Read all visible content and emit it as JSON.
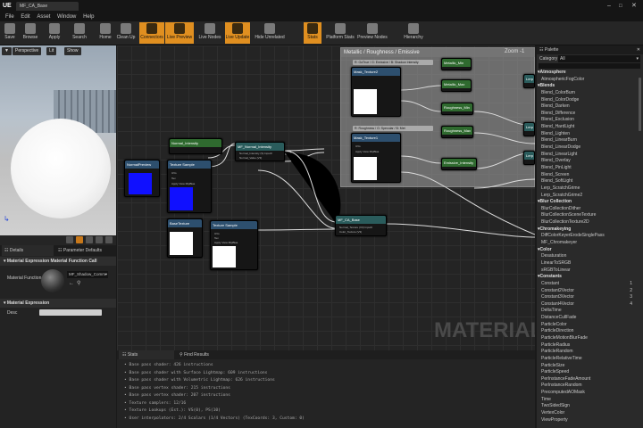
{
  "window": {
    "title": "MF_CA_Base",
    "logo": "UE"
  },
  "menu": [
    "File",
    "Edit",
    "Asset",
    "Window",
    "Help"
  ],
  "toolbar": [
    {
      "label": "Save",
      "icon": "save-icon"
    },
    {
      "label": "Browse",
      "icon": "browse-icon"
    },
    {
      "label": "Apply",
      "icon": "apply-icon"
    },
    {
      "label": "Search",
      "icon": "search-icon"
    },
    {
      "label": "Home",
      "icon": "home-icon"
    },
    {
      "label": "Clean Up",
      "icon": "clean-up-icon"
    },
    {
      "label": "Connectors",
      "icon": "connectors-icon",
      "active": true
    },
    {
      "label": "Live Preview",
      "icon": "live-preview-icon",
      "active": true
    },
    {
      "label": "Live Nodes",
      "icon": "live-nodes-icon"
    },
    {
      "label": "Live Update",
      "icon": "live-update-icon",
      "active": true
    },
    {
      "label": "Hide Unrelated",
      "icon": "hide-unrelated-icon"
    },
    {
      "label": "Stats",
      "icon": "stats-icon",
      "active": true
    },
    {
      "label": "Platform Stats",
      "icon": "platform-stats-icon"
    },
    {
      "label": "Preview Nodes",
      "icon": "preview-nodes-icon"
    },
    {
      "label": "Hierarchy",
      "icon": "hierarchy-icon"
    }
  ],
  "viewport": {
    "perspective": "Perspective",
    "lit": "Lit",
    "show": "Show"
  },
  "details": {
    "tab1": "Details",
    "tab2": "Parameter Defaults",
    "section1": "Material Expression Material Function Call",
    "function_label": "Material Function",
    "function_value": "MF_Shadow_Comm",
    "section2": "Material Expression",
    "desc_label": "Desc"
  },
  "graph": {
    "comment_title": "Metallic / Roughness / Emissive",
    "zoom": "Zoom -1",
    "watermark": "MATERIAL"
  },
  "nodes": {
    "normal_preview": {
      "title": "NormalPreview",
      "sub": "Texture Sample"
    },
    "texture_sample_1": {
      "title": "Texture Sample",
      "pins": [
        "UVs",
        "Tex",
        "Apply View MipBias"
      ],
      "out": [
        "RGB",
        "R",
        "G",
        "B",
        "A",
        "RGBA"
      ]
    },
    "normal_intensity": {
      "title": "Normal_Intensity",
      "sub": "Param (1)"
    },
    "mf_normal_intensity": {
      "title": "MF_Normal_Intensity",
      "pins": [
        "Normal_Intensity (S) Input0",
        "Normal_Value (V3)"
      ]
    },
    "mf_ca_base": {
      "title": "MF_CA_Base",
      "pins": [
        "Normal_Texture (V3) Input0",
        "Color_Texture (V3)"
      ]
    },
    "base_texture": {
      "title": "BaseTexture",
      "sub": "Texture Sample"
    },
    "texture_sample_2": {
      "title": "Texture Sample",
      "pins": [
        "UVs",
        "Tex",
        "Apply View MipBias"
      ],
      "out": [
        "RGB",
        "R",
        "G",
        "B",
        "A",
        "RGBA"
      ]
    },
    "mask_texture": {
      "title": "Mask_Texture2",
      "sub": "Texture Sample",
      "pins": [
        "UVs",
        "Tex",
        "Apply View MipBias"
      ]
    },
    "mask_texture2": {
      "title": "Mask_Texture1",
      "sub": "Texture Sample",
      "pins": [
        "UVs",
        "Tex",
        "Apply View MipBias"
      ]
    },
    "reroute_labels": [
      "R: GaTrue / G: Emissive / B: Shadow Intensity",
      "R: Roughness / G: Specular / B: Met"
    ],
    "metallic_min": "Metallic_Min",
    "metallic_max": "Metallic_Max",
    "roughness_min": "Roughness_Min",
    "roughness_max": "Roughness_Max",
    "emissive_intensity": "Emissive_Intensity",
    "lerp": "Lerp"
  },
  "stats": {
    "tab1": "Stats",
    "tab2": "Find Results",
    "lines": [
      "Base pass shader: 426 instructions",
      "Base pass shader with Surface Lightmap: 609 instructions",
      "Base pass shader with Volumetric Lightmap: 626 instructions",
      "Base pass vertex shader: 215 instructions",
      "Base pass vertex shader: 207 instructions",
      "Texture samplers: 12/16",
      "Texture Lookups (Est.): VS(0), PS(10)",
      "User interpolators: 2/4 Scalars (1/4 Vectors) (TexCoords: 3, Custom: 0)"
    ]
  },
  "palette": {
    "title": "Palette",
    "category_label": "Category",
    "category_value": "All",
    "items": [
      {
        "label": "Atmosphere",
        "cat": true
      },
      {
        "label": "AtmosphericFogColor"
      },
      {
        "label": "Blends",
        "cat": true
      },
      {
        "label": "Blend_ColorBurn"
      },
      {
        "label": "Blend_ColorDodge"
      },
      {
        "label": "Blend_Darken"
      },
      {
        "label": "Blend_Difference"
      },
      {
        "label": "Blend_Exclusion"
      },
      {
        "label": "Blend_HardLight"
      },
      {
        "label": "Blend_Lighten"
      },
      {
        "label": "Blend_LinearBurn"
      },
      {
        "label": "Blend_LinearDodge"
      },
      {
        "label": "Blend_LinearLight"
      },
      {
        "label": "Blend_Overlay"
      },
      {
        "label": "Blend_PinLight"
      },
      {
        "label": "Blend_Screen"
      },
      {
        "label": "Blend_SoftLight"
      },
      {
        "label": "Lerp_ScratchGrime"
      },
      {
        "label": "Lerp_ScratchGrime2"
      },
      {
        "label": "Blur Collection",
        "cat": true
      },
      {
        "label": "BlurCollectionDither"
      },
      {
        "label": "BlurCollectionSceneTexture"
      },
      {
        "label": "BlurCollectionTexture2D"
      },
      {
        "label": "Chromakeying",
        "cat": true
      },
      {
        "label": "DiffColorKeyerErodeSinglePass"
      },
      {
        "label": "MF_Chromakeyer"
      },
      {
        "label": "Color",
        "cat": true
      },
      {
        "label": "Desaturation"
      },
      {
        "label": "LinearToSRGB"
      },
      {
        "label": "sRGBToLinear"
      },
      {
        "label": "Constants",
        "cat": true
      },
      {
        "label": "Constant",
        "num": "1"
      },
      {
        "label": "Constant2Vector",
        "num": "2"
      },
      {
        "label": "Constant3Vector",
        "num": "3"
      },
      {
        "label": "Constant4Vector",
        "num": "4"
      },
      {
        "label": "DeltaTime"
      },
      {
        "label": "DistanceCullFade"
      },
      {
        "label": "ParticleColor"
      },
      {
        "label": "ParticleDirection"
      },
      {
        "label": "ParticleMotionBlurFade"
      },
      {
        "label": "ParticleRadius"
      },
      {
        "label": "ParticleRandom"
      },
      {
        "label": "ParticleRelativeTime"
      },
      {
        "label": "ParticleSize"
      },
      {
        "label": "ParticleSpeed"
      },
      {
        "label": "PerInstanceFadeAmount"
      },
      {
        "label": "PerInstanceRandom"
      },
      {
        "label": "PrecomputedAOMask"
      },
      {
        "label": "Time"
      },
      {
        "label": "TwoSidedSign"
      },
      {
        "label": "VertexColor"
      },
      {
        "label": "ViewProperty"
      }
    ]
  },
  "colors": {
    "accent": "#e08f20",
    "node_header_blue": "#2d4f6e",
    "node_header_green": "#2f6a2f",
    "node_header_teal": "#2a5c5c",
    "swatch_blue": "#1010ff"
  }
}
